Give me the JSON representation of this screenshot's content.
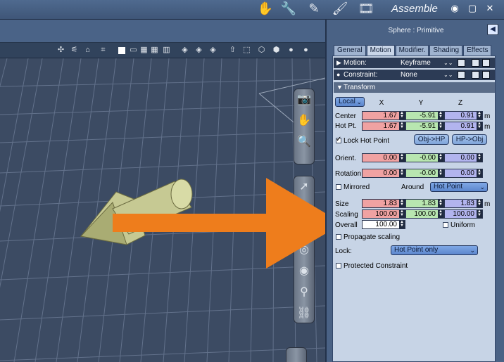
{
  "header": {
    "room_title": "Assemble",
    "room_icons": [
      "hand-icon",
      "wrench-icon",
      "pencil-icon",
      "brush-icon",
      "film-icon"
    ],
    "window_buttons": [
      "eye-icon",
      "restore-icon",
      "close-icon"
    ]
  },
  "panel": {
    "title": "Sphere : Primitive",
    "tabs": [
      "General",
      "Motion",
      "Modifier.",
      "Shading",
      "Effects"
    ],
    "active_tab": "Motion",
    "motion_label": "Motion:",
    "motion_value": "Keyframe",
    "constraint_label": "Constraint:",
    "constraint_value": "None",
    "transform_label": "Transform",
    "coord_space": "Local",
    "col_x": "X",
    "col_y": "Y",
    "col_z": "Z",
    "rows": {
      "center": {
        "label": "Center",
        "x": "1.67",
        "y": "-5.91",
        "z": "0.91",
        "unit": "m"
      },
      "hotpt": {
        "label": "Hot Pt.",
        "x": "1.67",
        "y": "-5.91",
        "z": "0.91",
        "unit": "m"
      },
      "orient": {
        "label": "Orient.",
        "x": "0.00",
        "y": "-0.00",
        "z": "0.00"
      },
      "rotation": {
        "label": "Rotation",
        "x": "0.00",
        "y": "-0.00",
        "z": "0.00"
      },
      "size": {
        "label": "Size",
        "x": "1.83",
        "y": "1.83",
        "z": "1.83",
        "unit": "m"
      },
      "scaling": {
        "label": "Scaling",
        "x": "100.00",
        "y": "100.00",
        "z": "100.00"
      },
      "overall": {
        "label": "Overall",
        "value": "100.00"
      }
    },
    "lock_hot_point": "Lock Hot Point",
    "obj_to_hp": "Obj->HP",
    "hp_to_obj": "HP->Obj",
    "mirrored": "Mirrored",
    "around_label": "Around",
    "around_value": "Hot Point",
    "uniform": "Uniform",
    "propagate_scaling": "Propagate scaling",
    "lock_label": "Lock:",
    "lock_value": "Hot Point only",
    "protected_constraint": "Protected Constraint",
    "lock_hot_point_checked": true,
    "mirrored_checked": false,
    "uniform_checked": false,
    "propagate_checked": false,
    "protected_checked": false
  },
  "colors": {
    "x_field": "#f0a2a2",
    "y_field": "#b8e6b0",
    "z_field": "#b2b4ee",
    "overlay_arrow": "#ee7d1c",
    "object": "#c6c993"
  }
}
